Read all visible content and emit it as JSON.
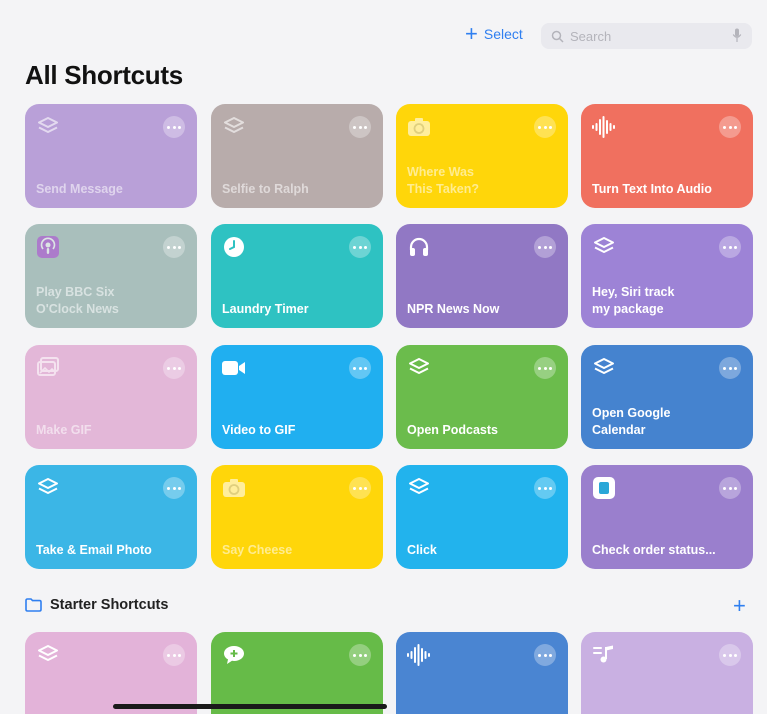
{
  "toolbar": {
    "add_symbol": "+",
    "select_label": "Select",
    "search_placeholder": "Search"
  },
  "page_title": "All Shortcuts",
  "shortcuts": [
    {
      "label": "Send Message",
      "color": "#b9a0d8",
      "icon": "layers-icon",
      "faded": true
    },
    {
      "label": "Selfie to Ralph",
      "color": "#b8acab",
      "icon": "layers-icon",
      "faded": true
    },
    {
      "label": "Where Was\nThis Taken?",
      "color": "#ffd60a",
      "icon": "camera-icon",
      "faded": true
    },
    {
      "label": "Turn Text Into Audio",
      "color": "#f0705f",
      "icon": "waveform-icon",
      "faded": false
    },
    {
      "label": "Play BBC Six\nO'Clock News",
      "color": "#a9bfbc",
      "icon": "podcasts-app-icon",
      "faded": true
    },
    {
      "label": "Laundry Timer",
      "color": "#2ec2c2",
      "icon": "clock-icon",
      "faded": false
    },
    {
      "label": "NPR News Now",
      "color": "#9178c4",
      "icon": "headphones-icon",
      "faded": false
    },
    {
      "label": "Hey, Siri track\nmy package",
      "color": "#9d83d6",
      "icon": "layers-icon",
      "faded": false
    },
    {
      "label": "Make GIF",
      "color": "#e3b7d8",
      "icon": "photos-icon",
      "faded": true
    },
    {
      "label": "Video to GIF",
      "color": "#20aff0",
      "icon": "video-icon",
      "faded": false
    },
    {
      "label": "Open Podcasts",
      "color": "#6bbc4c",
      "icon": "layers-icon",
      "faded": false
    },
    {
      "label": "Open Google\nCalendar",
      "color": "#4583cf",
      "icon": "layers-icon",
      "faded": false
    },
    {
      "label": "Take & Email Photo",
      "color": "#3bb6e6",
      "icon": "layers-icon",
      "faded": false
    },
    {
      "label": "Say Cheese",
      "color": "#ffd60a",
      "icon": "camera-icon",
      "faded": true
    },
    {
      "label": "Click",
      "color": "#22b3ed",
      "icon": "layers-icon",
      "faded": false
    },
    {
      "label": "Check order status...",
      "color": "#9a7fcd",
      "icon": "app-icon",
      "faded": false
    }
  ],
  "starter_section": {
    "title": "Starter Shortcuts",
    "add_symbol": "+"
  },
  "starter_shortcuts": [
    {
      "color": "#e3b3d9",
      "icon": "layers-icon"
    },
    {
      "color": "#66bb48",
      "icon": "message-icon"
    },
    {
      "color": "#4a85d2",
      "icon": "waveform-icon"
    },
    {
      "color": "#c9b0e2",
      "icon": "music-queue-icon"
    }
  ]
}
